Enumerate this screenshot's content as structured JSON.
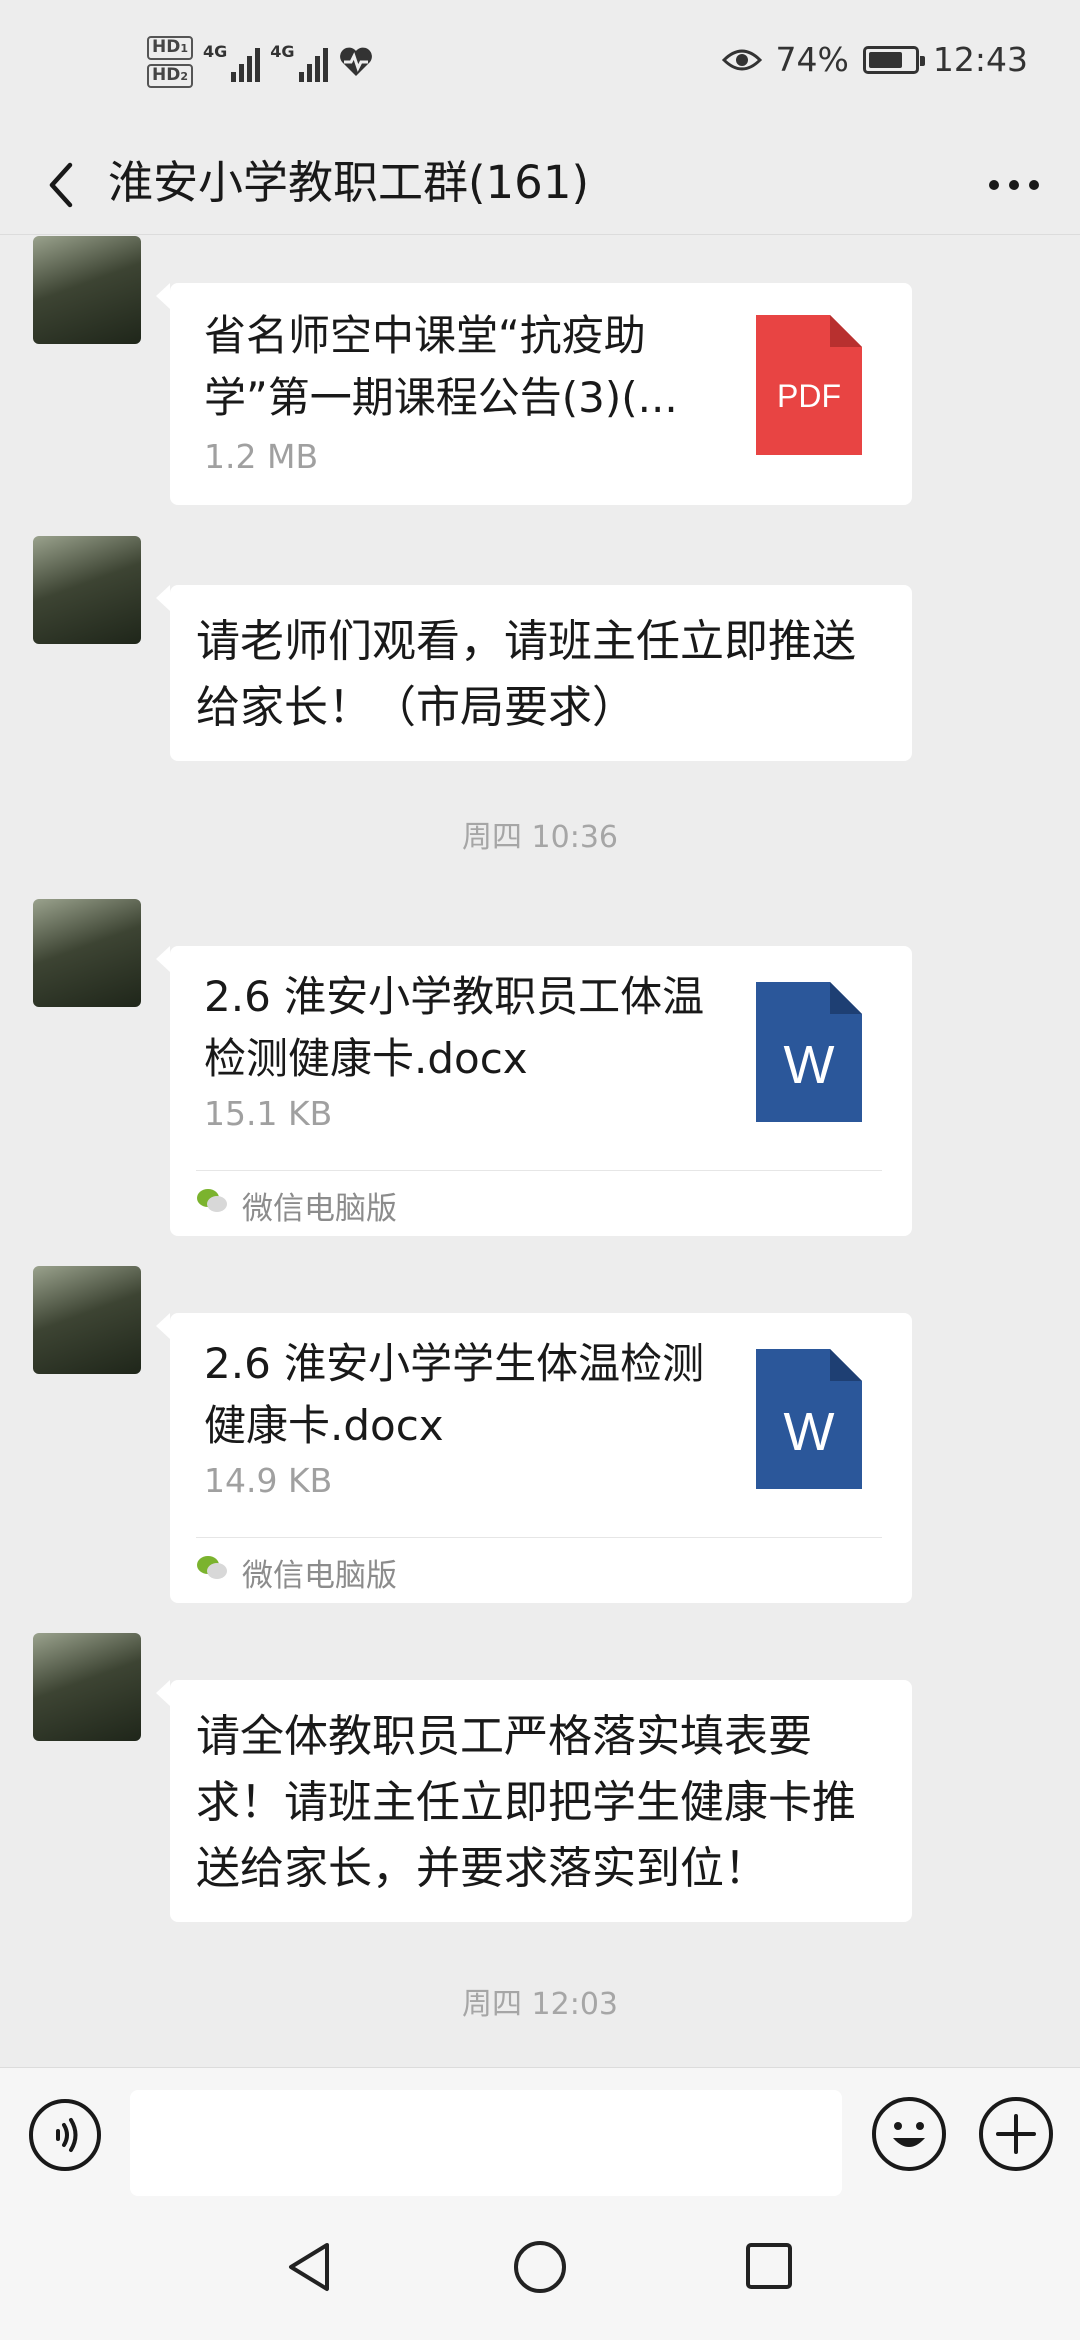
{
  "status_bar": {
    "hd1": "HD",
    "hd1_sub": "1",
    "hd2": "HD",
    "hd2_sub": "2",
    "signal1_label": "4G",
    "signal2_label": "4G",
    "battery_percent": "74%",
    "battery_level": 0.74,
    "time": "12:43"
  },
  "header": {
    "title": "淮安小学教职工群(161)"
  },
  "messages": [
    {
      "type": "file",
      "name": "省名师空中课堂“抗疫助学”第一期课程公告(3)(...",
      "size": "1.2 MB",
      "file_icon": "PDF",
      "icon_color": "#e84443"
    },
    {
      "type": "text",
      "text": "请老师们观看，请班主任立即推送给家长！（市局要求）"
    },
    {
      "type": "time",
      "text": "周四 10:36"
    },
    {
      "type": "file",
      "name": "2.6 淮安小学教职员工体温检测健康卡.docx",
      "size": "15.1 KB",
      "file_icon": "W",
      "icon_color": "#2b579a",
      "source": "微信电脑版"
    },
    {
      "type": "file",
      "name": "2.6 淮安小学学生体温检测健康卡.docx",
      "size": "14.9 KB",
      "file_icon": "W",
      "icon_color": "#2b579a",
      "source": "微信电脑版"
    },
    {
      "type": "text",
      "text": "请全体教职员工严格落实填表要求！请班主任立即把学生健康卡推送给家长，并要求落实到位！"
    },
    {
      "type": "time",
      "text": "周四 12:03"
    }
  ],
  "input": {
    "value": "",
    "placeholder": ""
  },
  "icons": {
    "back": "chevron-left-icon",
    "more": "ellipsis-icon",
    "voice": "voice-icon",
    "emoji": "smiley-icon",
    "plus": "plus-icon",
    "wechat": "wechat-icon"
  }
}
